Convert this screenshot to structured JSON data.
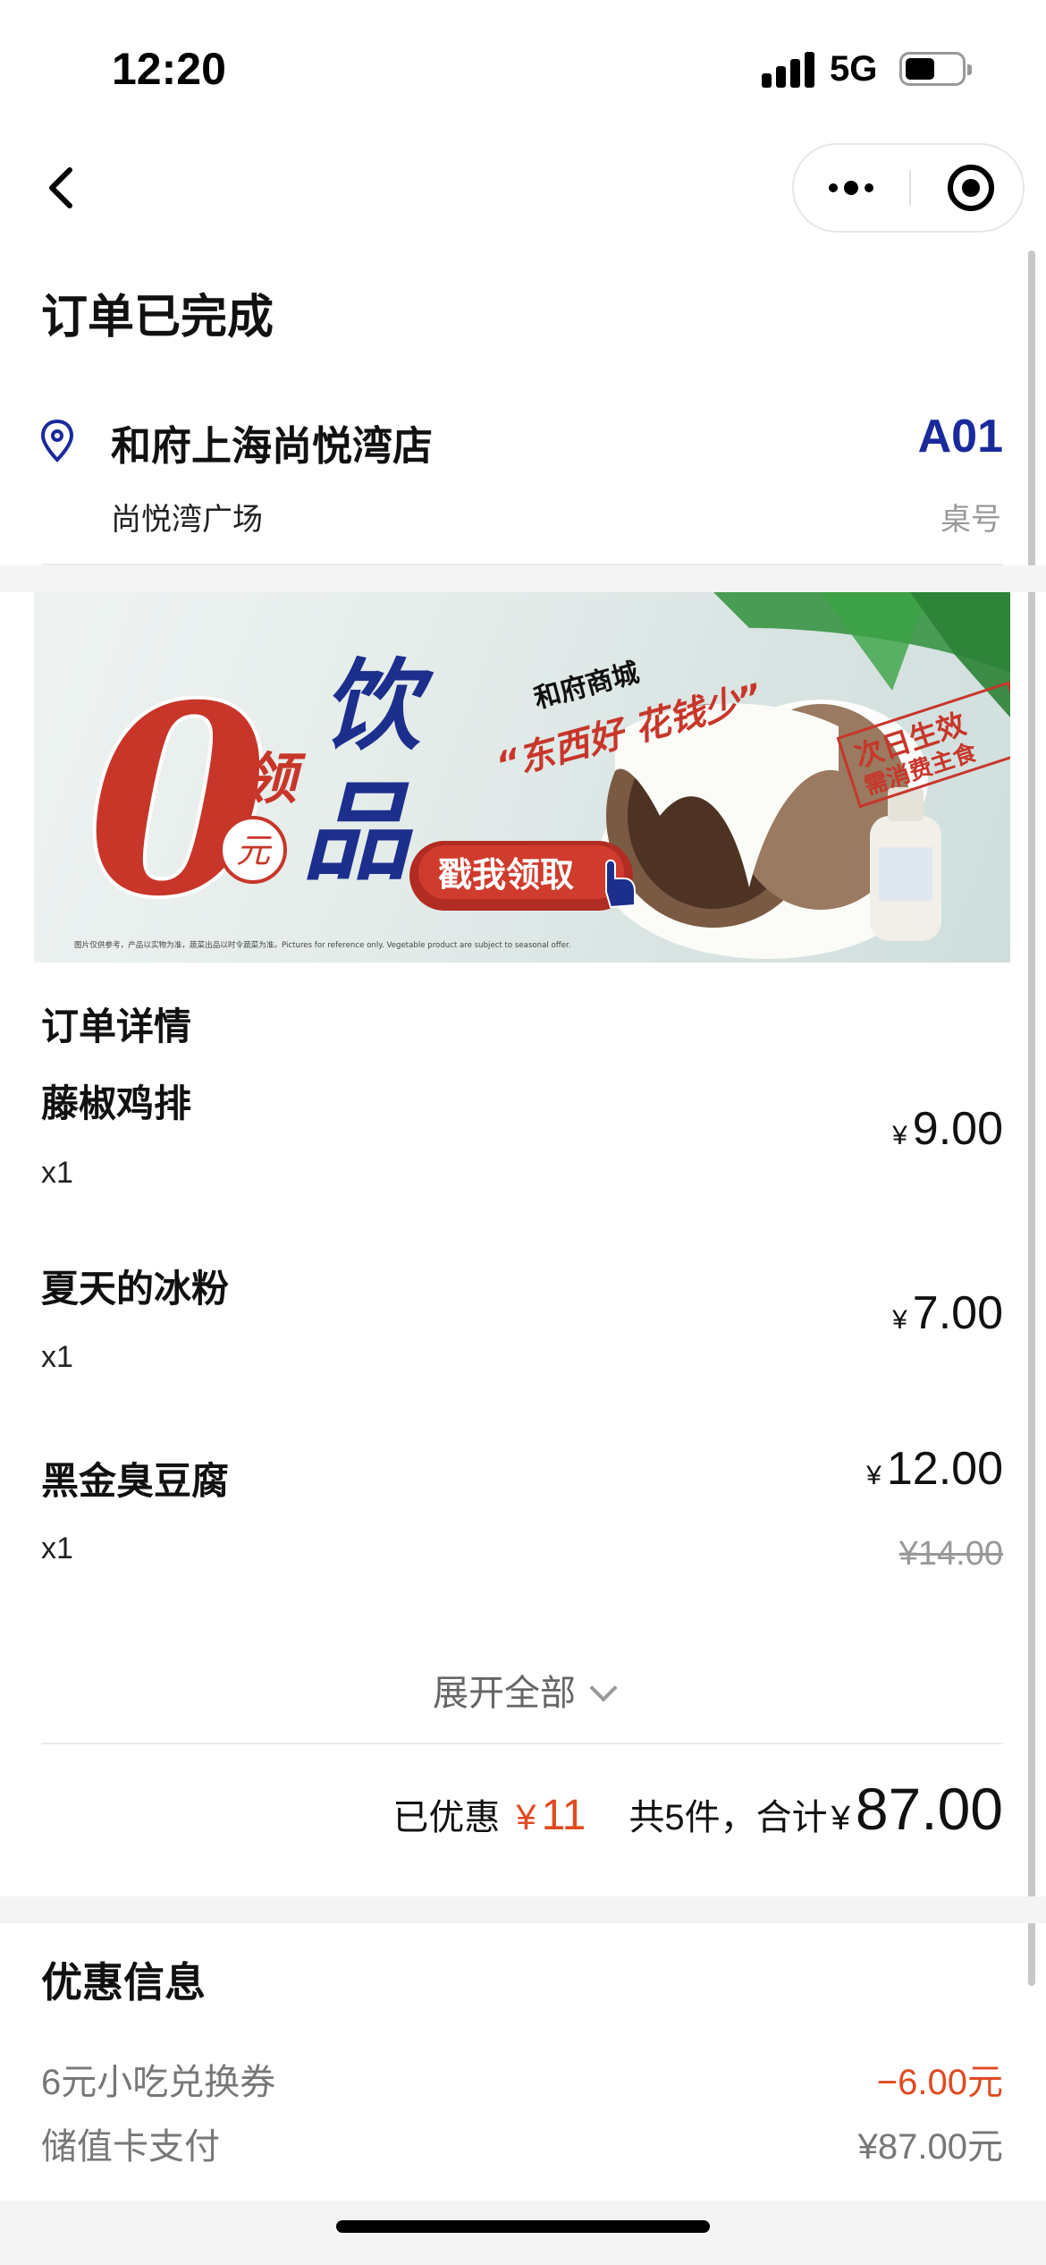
{
  "status_bar": {
    "time": "12:20",
    "network": "5G"
  },
  "order": {
    "status_title": "订单已完成"
  },
  "store": {
    "name": "和府上海尚悦湾店",
    "area": "尚悦湾广场",
    "table_number": "A01",
    "table_label": "桌号"
  },
  "banner": {
    "big_zero": "0",
    "yuan": "元",
    "ling": "领",
    "drink_1": "饮",
    "drink_2": "品",
    "brand": "和府商城",
    "slogan": "“东西好 花钱少”",
    "cta": "戳我领取",
    "stamp_line1": "次日生效",
    "stamp_line2": "需消费主食",
    "disclaimer": "图片仅供参考，产品以实物为准，蔬菜出品以时令蔬菜为准。Pictures for reference only. Vegetable product are subject to seasonal offer."
  },
  "details": {
    "title": "订单详情",
    "currency": "¥",
    "items": [
      {
        "name": "藤椒鸡排",
        "qty": "x1",
        "price": "9.00"
      },
      {
        "name": "夏天的冰粉",
        "qty": "x1",
        "price": "7.00"
      },
      {
        "name": "黑金臭豆腐",
        "qty": "x1",
        "price": "12.00",
        "original_price": "¥14.00"
      }
    ],
    "expand_label": "展开全部"
  },
  "summary": {
    "discount_label": "已优惠",
    "discount_currency": "¥",
    "discount_value": "11",
    "count_label": "共5件，合计",
    "total_currency": "¥",
    "total_value": "87.00"
  },
  "promotions": {
    "title": "优惠信息",
    "rows": [
      {
        "label": "6元小吃兑换券",
        "value": "−6.00元"
      },
      {
        "label": "储值卡支付",
        "value": "¥87.00元"
      }
    ]
  },
  "colors": {
    "accent_red": "#e04a21",
    "table_blue": "#1a2a9c",
    "banner_red": "#c8362a",
    "banner_blue": "#1d2f8c"
  },
  "icons": {
    "back": "chevron-left-icon",
    "more": "more-dots-icon",
    "close": "target-circle-icon",
    "location": "location-pin-icon",
    "expand": "chevron-down-icon"
  }
}
